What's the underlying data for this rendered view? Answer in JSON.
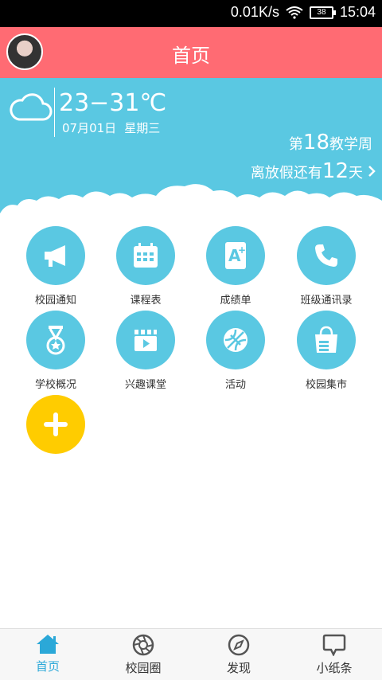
{
  "status_bar": {
    "speed": "0.01K/s",
    "battery": "38",
    "time": "15:04"
  },
  "header": {
    "title": "首页"
  },
  "weather": {
    "temperature": "23−31℃",
    "date": "07月01日",
    "weekday": "星期三",
    "week_prefix": "第",
    "week_number": "18",
    "week_suffix": "教学周",
    "vacation_prefix": "离放假还有",
    "vacation_days": "12",
    "vacation_suffix": "天"
  },
  "grid": {
    "items": [
      {
        "label": "校园通知",
        "icon": "megaphone-icon"
      },
      {
        "label": "课程表",
        "icon": "calendar-icon"
      },
      {
        "label": "成绩单",
        "icon": "grade-icon"
      },
      {
        "label": "班级通讯录",
        "icon": "phone-icon"
      },
      {
        "label": "学校概况",
        "icon": "medal-icon"
      },
      {
        "label": "兴趣课堂",
        "icon": "video-icon"
      },
      {
        "label": "活动",
        "icon": "ball-icon"
      },
      {
        "label": "校园集市",
        "icon": "shopping-bag-icon"
      }
    ],
    "add_icon": "plus-icon"
  },
  "bottom_nav": {
    "items": [
      {
        "label": "首页",
        "icon": "home-icon",
        "active": true
      },
      {
        "label": "校园圈",
        "icon": "aperture-icon"
      },
      {
        "label": "发现",
        "icon": "compass-icon"
      },
      {
        "label": "小纸条",
        "icon": "chat-bubble-icon"
      }
    ]
  },
  "colors": {
    "header": "#ff6b73",
    "sky": "#5ac8e2",
    "add": "#ffcc00",
    "active_tab": "#2ba8d8"
  }
}
